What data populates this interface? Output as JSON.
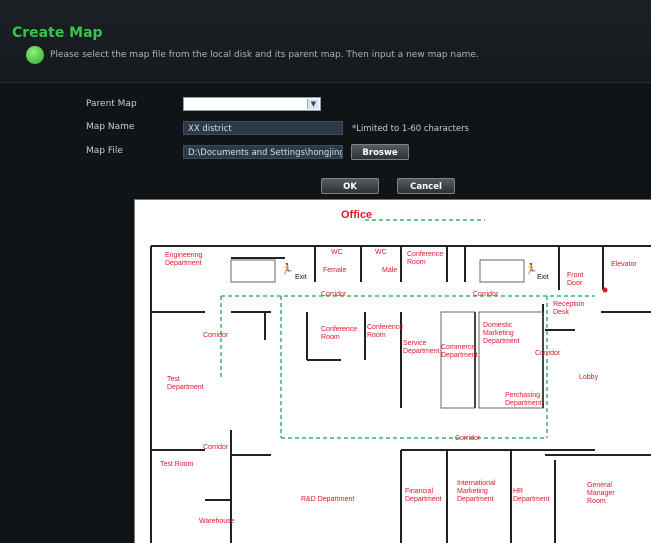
{
  "window": {
    "title": "Create Map"
  },
  "hint": {
    "text": "Please select the map file from the local disk and its parent map. Then input a new map name."
  },
  "form": {
    "parent_map_label": "Parent Map",
    "parent_map_value": "",
    "map_name_label": "Map Name",
    "map_name_value": "XX district",
    "map_name_note": "*Limited to 1-60 characters",
    "map_file_label": "Map File",
    "map_file_value": "D:\\Documents and Settings\\hongjing\\De",
    "browse_label": "Broswe"
  },
  "buttons": {
    "ok": "OK",
    "cancel": "Cancel"
  },
  "floorplan": {
    "title": "Office",
    "exit1": "Exit",
    "exit2": "Exit",
    "rooms": {
      "engineering": "Engineering Department",
      "wc_female_1": "WC",
      "wc_female_2": "Female",
      "wc_male_1": "WC",
      "wc_male_2": "Male",
      "conference_top": "Conference Room",
      "front_door": "Front Door",
      "elevator": "Elevator",
      "corridor_top1": "Corridor",
      "corridor_top2": "Corridor",
      "reception": "Reception Desk",
      "corridor_left1": "Corridor",
      "conference_a": "Conference Room",
      "conference_b": "Conference Room",
      "service": "Service Department",
      "commerce": "Commerce Department",
      "domestic": "Domestic Marketing Department",
      "corridor_right": "Corridor",
      "test": "Test Department",
      "lobby": "Lobby",
      "purchasing": "Perchasing Department",
      "corridor_bottom": "Corridor",
      "corridor_left2": "Corridor",
      "test_room": "Test Room",
      "rd": "R&D Department",
      "financial": "Financial Department",
      "international": "International Marketing Department",
      "hr": "HR Department",
      "general_manager": "General Manager Room",
      "warehouse": "Warehouse"
    }
  },
  "colors": {
    "title_green": "#36c44a",
    "plan_red": "#d8182d",
    "corridor_green": "#3cb371"
  }
}
